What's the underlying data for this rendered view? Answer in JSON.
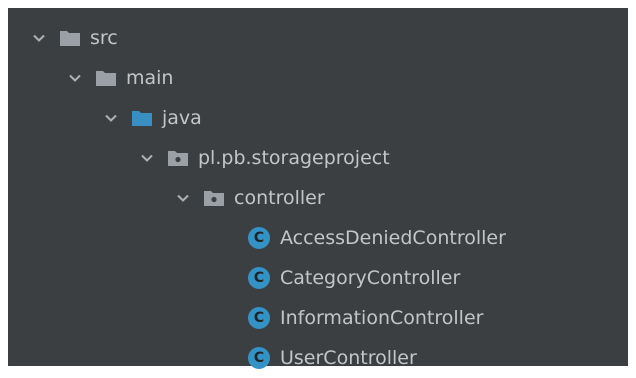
{
  "tree": {
    "items": [
      {
        "label": "src",
        "type": "folder",
        "expanded": true
      },
      {
        "label": "main",
        "type": "folder",
        "expanded": true
      },
      {
        "label": "java",
        "type": "source-folder",
        "expanded": true
      },
      {
        "label": "pl.pb.storageproject",
        "type": "package",
        "expanded": true
      },
      {
        "label": "controller",
        "type": "package",
        "expanded": true
      },
      {
        "label": "AccessDeniedController",
        "type": "class",
        "icon_letter": "C"
      },
      {
        "label": "CategoryController",
        "type": "class",
        "icon_letter": "C"
      },
      {
        "label": "InformationController",
        "type": "class",
        "icon_letter": "C"
      },
      {
        "label": "UserController",
        "type": "class",
        "icon_letter": "C"
      }
    ]
  },
  "colors": {
    "panel_bg": "#3c3f41",
    "text": "#c3c5c8",
    "folder": "#9aa0a6",
    "source_folder": "#3a8fc2",
    "class_icon": "#3592c4"
  }
}
